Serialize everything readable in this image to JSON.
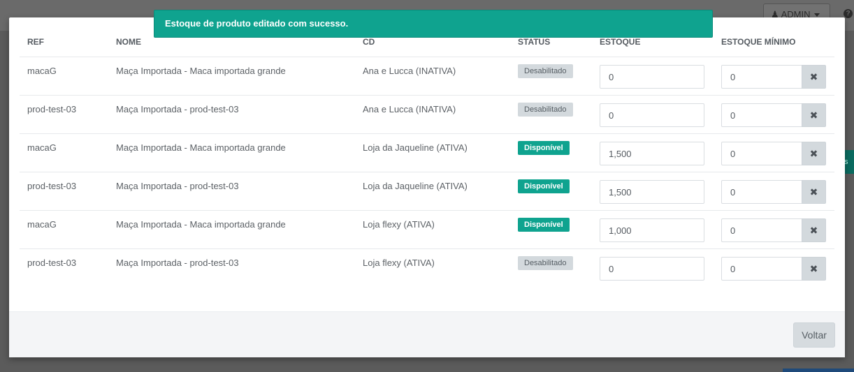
{
  "backdrop": {
    "admin_label": "ADMIN",
    "help_label": "?",
    "green_text": "s"
  },
  "toast": {
    "message": "Estoque de produto editado com sucesso."
  },
  "table": {
    "headers": {
      "ref": "REF",
      "nome": "NOME",
      "cd": "CD",
      "status": "STATUS",
      "estoque": "ESTOQUE",
      "estoque_minimo": "ESTOQUE MÍNIMO"
    },
    "rows": [
      {
        "ref": "macaG",
        "nome": "Maça Importada - Maca importada grande",
        "cd": "Ana e Lucca (INATIVA)",
        "status": "Desabilitado",
        "estoque": "0",
        "estoque_minimo": "0"
      },
      {
        "ref": "prod-test-03",
        "nome": "Maça Importada - prod-test-03",
        "cd": "Ana e Lucca (INATIVA)",
        "status": "Desabilitado",
        "estoque": "0",
        "estoque_minimo": "0"
      },
      {
        "ref": "macaG",
        "nome": "Maça Importada - Maca importada grande",
        "cd": "Loja da Jaqueline (ATIVA)",
        "status": "Disponível",
        "estoque": "1,500",
        "estoque_minimo": "0"
      },
      {
        "ref": "prod-test-03",
        "nome": "Maça Importada - prod-test-03",
        "cd": "Loja da Jaqueline (ATIVA)",
        "status": "Disponível",
        "estoque": "1,500",
        "estoque_minimo": "0"
      },
      {
        "ref": "macaG",
        "nome": "Maça Importada - Maca importada grande",
        "cd": "Loja flexy (ATIVA)",
        "status": "Disponível",
        "estoque": "1,000",
        "estoque_minimo": "0"
      },
      {
        "ref": "prod-test-03",
        "nome": "Maça Importada - prod-test-03",
        "cd": "Loja flexy (ATIVA)",
        "status": "Desabilitado",
        "estoque": "0",
        "estoque_minimo": "0"
      }
    ],
    "clear_icon_glyph": "✖"
  },
  "footer": {
    "voltar_label": "Voltar"
  },
  "colors": {
    "accent": "#0fa38f",
    "badge_disabled": "#d3d9dd"
  }
}
